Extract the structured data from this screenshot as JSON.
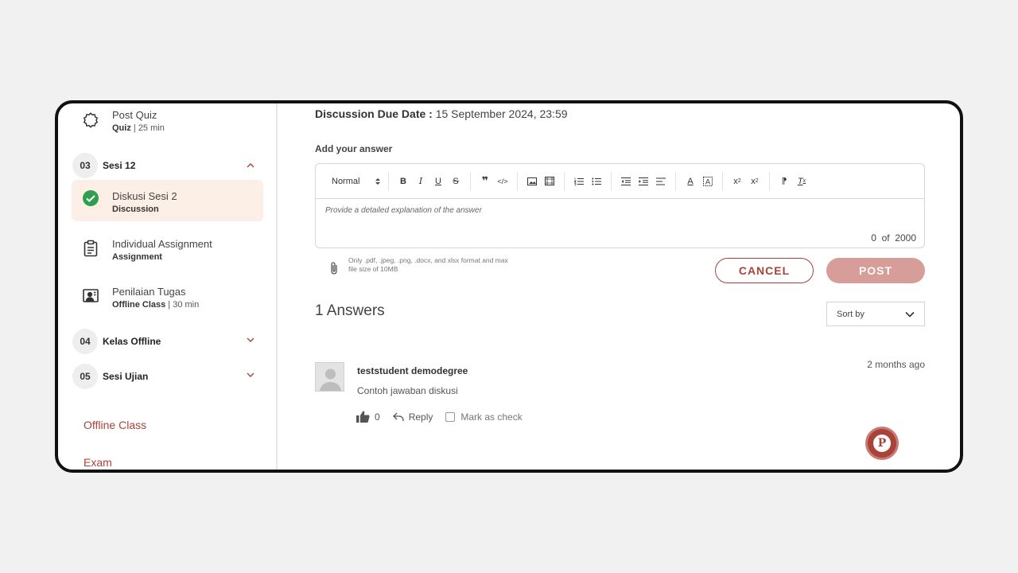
{
  "sidebar": {
    "post_quiz": {
      "title": "Post Quiz",
      "type": "Quiz",
      "duration": " | 25 min"
    },
    "section_12": {
      "number": "03",
      "title": "Sesi 12"
    },
    "diskusi": {
      "title": "Diskusi Sesi 2",
      "type": "Discussion"
    },
    "assignment": {
      "title": "Individual Assignment",
      "type": "Assignment"
    },
    "penilaian": {
      "title": "Penilaian Tugas",
      "type": "Offline Class",
      "duration": " | 30 min"
    },
    "section_offline": {
      "number": "04",
      "title": "Kelas Offline"
    },
    "section_ujian": {
      "number": "05",
      "title": "Sesi Ujian"
    },
    "links": {
      "offline_class": "Offline Class",
      "exam": "Exam"
    }
  },
  "discussion": {
    "due_label": "Discussion Due Date :",
    "due_value": " 15 September 2024, 23:59",
    "add_answer_label": "Add your answer",
    "editor": {
      "format_select": "Normal",
      "placeholder": "Provide a detailed explanation of the answer",
      "count": "0",
      "count_sep": "of",
      "count_max": "2000"
    },
    "attachment_note": "Only .pdf, .jpeg, .png, .docx, and xlsx format and max file size of 10MB",
    "cancel_label": "CANCEL",
    "post_label": "POST"
  },
  "answers": {
    "title": "1 Answers",
    "sort_label": "Sort by",
    "items": [
      {
        "user": "teststudent demodegree",
        "time": "2 months ago",
        "text": "Contoh jawaban diskusi",
        "likes": "0",
        "reply_label": "Reply",
        "mark_label": "Mark as check"
      }
    ]
  },
  "colors": {
    "accent": "#a9433a",
    "post_disabled": "#d79d98",
    "active_bg": "#fcf0e6",
    "check_green": "#2e9e4f"
  },
  "fab": {
    "icon": "P"
  }
}
